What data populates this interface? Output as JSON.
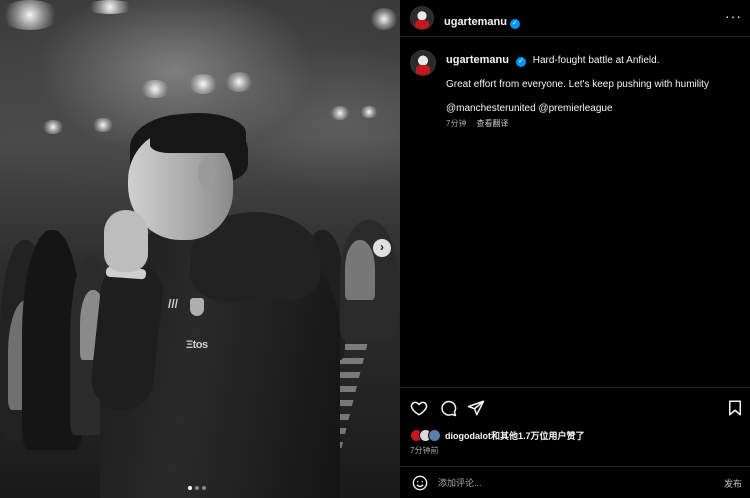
{
  "post": {
    "username": "ugartemanu",
    "verified": true,
    "more_label": "···",
    "caption": {
      "line1": "Hard-fought battle at Anfield.",
      "line2": "Great effort from everyone. Let's keep pushing with humility",
      "mentions": "@manchesterunited @premierleague"
    },
    "time_ago": "7分钟",
    "translate_label": "查看翻译",
    "likes_text": "diogodalot和其他1.7万位用户赞了",
    "posted_ago": "7分钟前"
  },
  "photo": {
    "jersey_text": "Ξtos",
    "next_label": "›",
    "carousel_total": 3,
    "carousel_active": 0
  },
  "comment": {
    "placeholder": "添加评论...",
    "post_label": "发布"
  },
  "icons": [
    "heart-icon",
    "comment-icon",
    "share-icon",
    "bookmark-icon",
    "emoji-icon",
    "verified-icon",
    "more-icon",
    "chevron-right-icon"
  ],
  "colors": {
    "background": "#000000",
    "verified": "#0095f6",
    "muted": "#a8a8a8",
    "divider": "#262626"
  }
}
